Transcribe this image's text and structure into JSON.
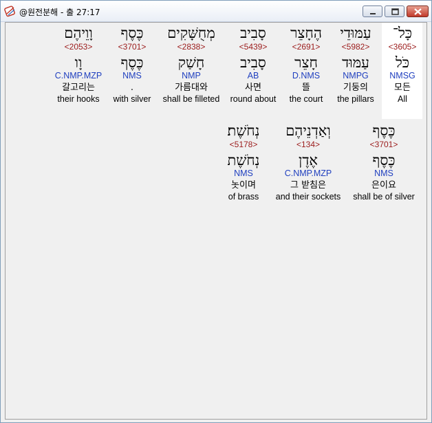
{
  "window": {
    "title": "@원전분해 - 출 27:17"
  },
  "row1": [
    {
      "heb": "כָּל־",
      "strong": "<3605>",
      "lex": "כֹּל",
      "parse": "NMSG",
      "kor": "모든",
      "eng": "All"
    },
    {
      "heb": "עַמּוּדֵי",
      "strong": "<5982>",
      "lex": "עַמּוּד",
      "parse": "NMPG",
      "kor": "기둥의",
      "eng": "the pillars"
    },
    {
      "heb": "הֶחָצֵר",
      "strong": "<2691>",
      "lex": "חָצֵר",
      "parse": "D.NMS",
      "kor": "뜰",
      "eng": "the court"
    },
    {
      "heb": "סָבִיב",
      "strong": "<5439>",
      "lex": "סָבִיב",
      "parse": "AB",
      "kor": "사면",
      "eng": "round about"
    },
    {
      "heb": "מְחֻשָּׁקִים",
      "strong": "<2838>",
      "lex": "חָשַׁק",
      "parse": "NMP",
      "kor": "가름대와",
      "eng": "shall be filleted"
    },
    {
      "heb": "כֶּסֶף",
      "strong": "<3701>",
      "lex": "כֶּסֶף",
      "parse": "NMS",
      "kor": ".",
      "eng": "with silver"
    },
    {
      "heb": "וָוֵיהֶם",
      "strong": "<2053>",
      "lex": "וָו",
      "parse": "C.NMP.MZP",
      "kor": "갈고리는",
      "eng": "their hooks"
    }
  ],
  "row2": [
    {
      "heb": "כֶּסֶף",
      "strong": "<3701>",
      "lex": "כֶּסֶף",
      "parse": "NMS",
      "kor": "은이요",
      "eng": "shall be of silver"
    },
    {
      "heb": "וְאַדְנֵיהֶם",
      "strong": "<134>",
      "lex": "אֶדֶן",
      "parse": "C.NMP.MZP",
      "kor": "그 받침은",
      "eng": "and their sockets"
    },
    {
      "heb": "נְחֹשֶׁת׃",
      "strong": "<5178>",
      "lex": "נְחֹשֶׁת",
      "parse": "NMS",
      "kor": "놋이며",
      "eng": "of brass"
    }
  ],
  "icons": {
    "app": "scroll-app-icon",
    "minimize": "minimize-icon",
    "maximize": "maximize-icon",
    "close": "close-icon"
  }
}
